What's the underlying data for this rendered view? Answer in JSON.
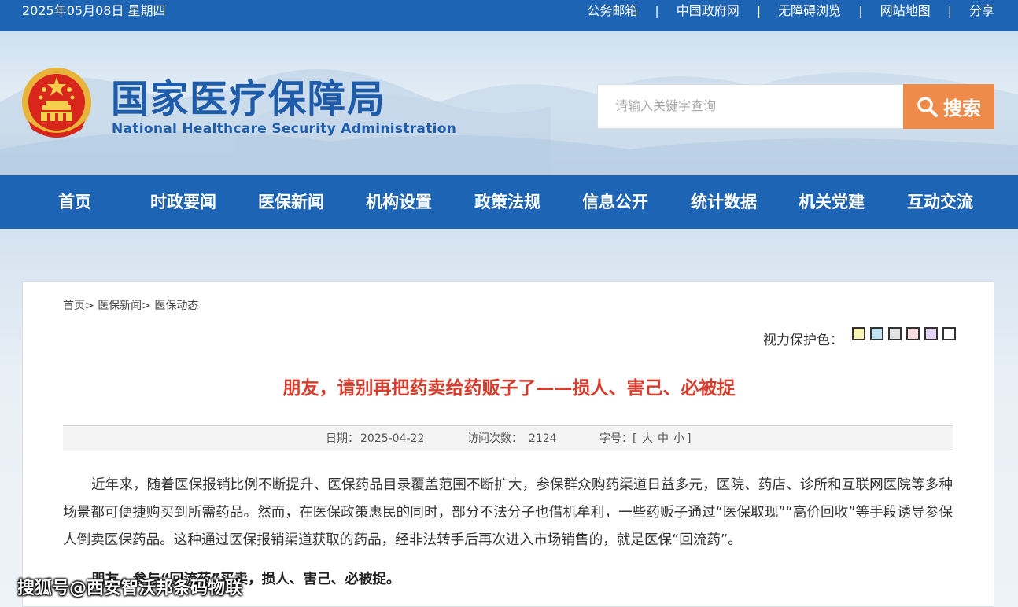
{
  "topbar": {
    "date": "2025年05月08日 星期四",
    "links": [
      "公务邮箱",
      "中国政府网",
      "无障碍浏览",
      "网站地图",
      "分享"
    ],
    "separator": "|"
  },
  "header": {
    "title_cn": "国家医疗保障局",
    "title_en": "National Healthcare Security Administration",
    "search_placeholder": "请输入关键字查询",
    "search_button": "搜索"
  },
  "nav": {
    "items": [
      "首页",
      "时政要闻",
      "医保新闻",
      "机构设置",
      "政策法规",
      "信息公开",
      "统计数据",
      "机关党建",
      "互动交流"
    ]
  },
  "breadcrumb": [
    "首页>",
    "医保新闻>",
    "医保动态"
  ],
  "eye_care": {
    "label": "视力保护色：",
    "colors": [
      "#f9f3b4",
      "#bfe3f0",
      "#e3e3e3",
      "#f8dbe0",
      "#e4d3f3",
      "#ffffff"
    ]
  },
  "article": {
    "title": "朋友，请别再把药卖给药贩子了——损人、害己、必被捉",
    "date_label": "日期：",
    "date": "2025-04-22",
    "views_label": "访问次数：",
    "views": "2124",
    "fontsize_label": "字号：[",
    "font_large": "大",
    "font_medium": "中",
    "font_small": "小",
    "fontsize_end": "]",
    "paragraph1": "近年来，随着医保报销比例不断提升、医保药品目录覆盖范围不断扩大，参保群众购药渠道日益多元，医院、药店、诊所和互联网医院等多种场景都可便捷购买到所需药品。然而，在医保政策惠民的同时，部分不法分子也借机牟利，一些药贩子通过“医保取现”“高价回收”等手段诱导参保人倒卖医保药品。这种通过医保报销渠道获取的药品，经非法转手后再次进入市场销售的，就是医保“回流药”。",
    "paragraph2": "朋友，参与“回流药”买卖，损人、害己、必被捉。"
  },
  "watermark": "搜狐号@西安智沃邦条码物联"
}
